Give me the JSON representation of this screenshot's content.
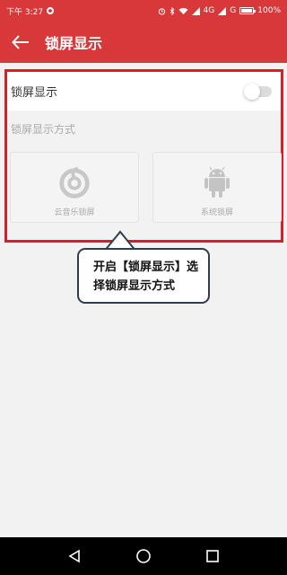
{
  "status_bar": {
    "time": "下午 3:27",
    "network": "4G",
    "signal_g": "G",
    "battery": "100%"
  },
  "app_bar": {
    "title": "锁屏显示",
    "back_icon": "arrow-left-icon"
  },
  "settings": {
    "toggle_label": "锁屏显示",
    "toggle_state": "off",
    "section_label": "锁屏显示方式",
    "options": [
      {
        "label": "云音乐锁屏",
        "icon": "netease-music-icon"
      },
      {
        "label": "系统锁屏",
        "icon": "android-icon"
      }
    ]
  },
  "callout": {
    "line1": "开启【锁屏显示】选",
    "line2": "择锁屏显示方式"
  },
  "nav_bar": {
    "back_icon": "triangle-back-icon",
    "home_icon": "circle-home-icon",
    "recents_icon": "square-recents-icon"
  },
  "colors": {
    "accent": "#d9383a",
    "highlight_border": "#e11b23",
    "callout_border": "#2f3d4e"
  }
}
